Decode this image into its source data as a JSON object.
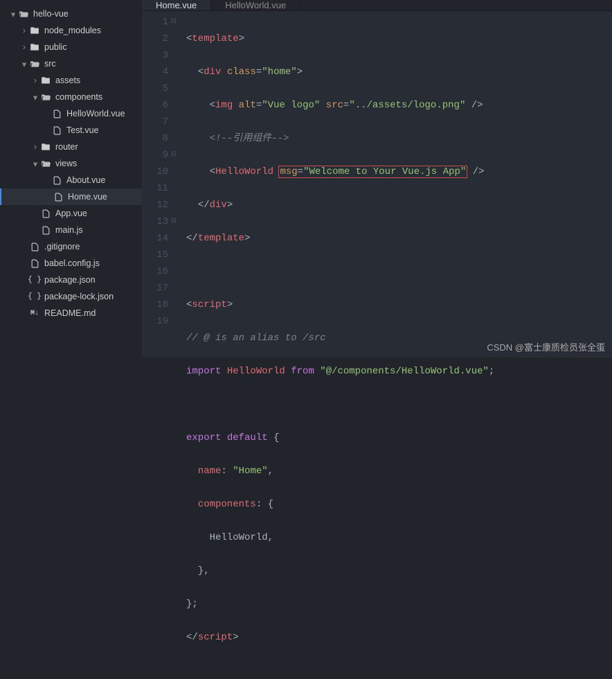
{
  "project": {
    "name": "hello-vue"
  },
  "tree": [
    {
      "indent": 14,
      "chev": "▾",
      "icon": "folder-open",
      "label": "hello-vue"
    },
    {
      "indent": 30,
      "chev": "›",
      "icon": "folder",
      "label": "node_modules"
    },
    {
      "indent": 30,
      "chev": "›",
      "icon": "folder",
      "label": "public"
    },
    {
      "indent": 30,
      "chev": "▾",
      "icon": "folder-open",
      "label": "src"
    },
    {
      "indent": 46,
      "chev": "›",
      "icon": "folder",
      "label": "assets"
    },
    {
      "indent": 46,
      "chev": "▾",
      "icon": "folder-open",
      "label": "components"
    },
    {
      "indent": 62,
      "chev": "",
      "icon": "file",
      "label": "HelloWorld.vue"
    },
    {
      "indent": 62,
      "chev": "",
      "icon": "file",
      "label": "Test.vue"
    },
    {
      "indent": 46,
      "chev": "›",
      "icon": "folder",
      "label": "router"
    },
    {
      "indent": 46,
      "chev": "▾",
      "icon": "folder-open",
      "label": "views"
    },
    {
      "indent": 62,
      "chev": "",
      "icon": "file",
      "label": "About.vue"
    },
    {
      "indent": 62,
      "chev": "",
      "icon": "file",
      "label": "Home.vue",
      "selected": true
    },
    {
      "indent": 46,
      "chev": "",
      "icon": "file",
      "label": "App.vue"
    },
    {
      "indent": 46,
      "chev": "",
      "icon": "file",
      "label": "main.js"
    },
    {
      "indent": 30,
      "chev": "",
      "icon": "file-dot",
      "label": ".gitignore"
    },
    {
      "indent": 30,
      "chev": "",
      "icon": "file",
      "label": "babel.config.js"
    },
    {
      "indent": 30,
      "chev": "",
      "icon": "json",
      "label": "package.json"
    },
    {
      "indent": 30,
      "chev": "",
      "icon": "json",
      "label": "package-lock.json"
    },
    {
      "indent": 30,
      "chev": "",
      "icon": "md",
      "label": "README.md"
    }
  ],
  "tabs": [
    {
      "label": "Home.vue",
      "active": true
    },
    {
      "label": "HelloWorld.vue",
      "active": false
    }
  ],
  "lines": [
    1,
    2,
    3,
    4,
    5,
    6,
    7,
    8,
    9,
    10,
    11,
    12,
    13,
    14,
    15,
    16,
    17,
    18,
    19
  ],
  "fold_lines": [
    1,
    9,
    13
  ],
  "code": {
    "l1": {
      "a": "<",
      "b": "template",
      "c": ">"
    },
    "l2": {
      "a": "  <",
      "b": "div",
      "c": " ",
      "d": "class",
      "e": "=",
      "f": "\"home\"",
      "g": ">"
    },
    "l3": {
      "a": "    <",
      "b": "img",
      "c": " ",
      "d": "alt",
      "e": "=",
      "f": "\"Vue logo\"",
      "g": " ",
      "h": "src",
      "i": "=",
      "j": "\"../assets/logo.png\"",
      "k": " />"
    },
    "l4": {
      "a": "    ",
      "b": "<!--引用组件-->"
    },
    "l5": {
      "a": "    <",
      "b": "HelloWorld",
      "c": " ",
      "d": "msg",
      "e": "=",
      "f": "\"Welcome to Your Vue.js App\"",
      "g": " />"
    },
    "l6": {
      "a": "  </",
      "b": "div",
      "c": ">"
    },
    "l7": {
      "a": "</",
      "b": "template",
      "c": ">"
    },
    "l9": {
      "a": "<",
      "b": "script",
      "c": ">"
    },
    "l10": {
      "a": "// @ is an alias to /src"
    },
    "l11": {
      "a": "import",
      "b": " HelloWorld ",
      "c": "from",
      "d": " ",
      "e": "\"@/components/HelloWorld.vue\"",
      "f": ";"
    },
    "l13": {
      "a": "export",
      "b": " ",
      "c": "default",
      "d": " {"
    },
    "l14": {
      "a": "  name",
      "b": ": ",
      "c": "\"Home\"",
      "d": ","
    },
    "l15": {
      "a": "  components",
      "b": ": {"
    },
    "l16": {
      "a": "    HelloWorld,"
    },
    "l17": {
      "a": "  },"
    },
    "l18": {
      "a": "};"
    },
    "l19": {
      "a": "</",
      "b": "script",
      "c": ">"
    }
  },
  "watermark": "CSDN @富士康质检员张全蛋"
}
